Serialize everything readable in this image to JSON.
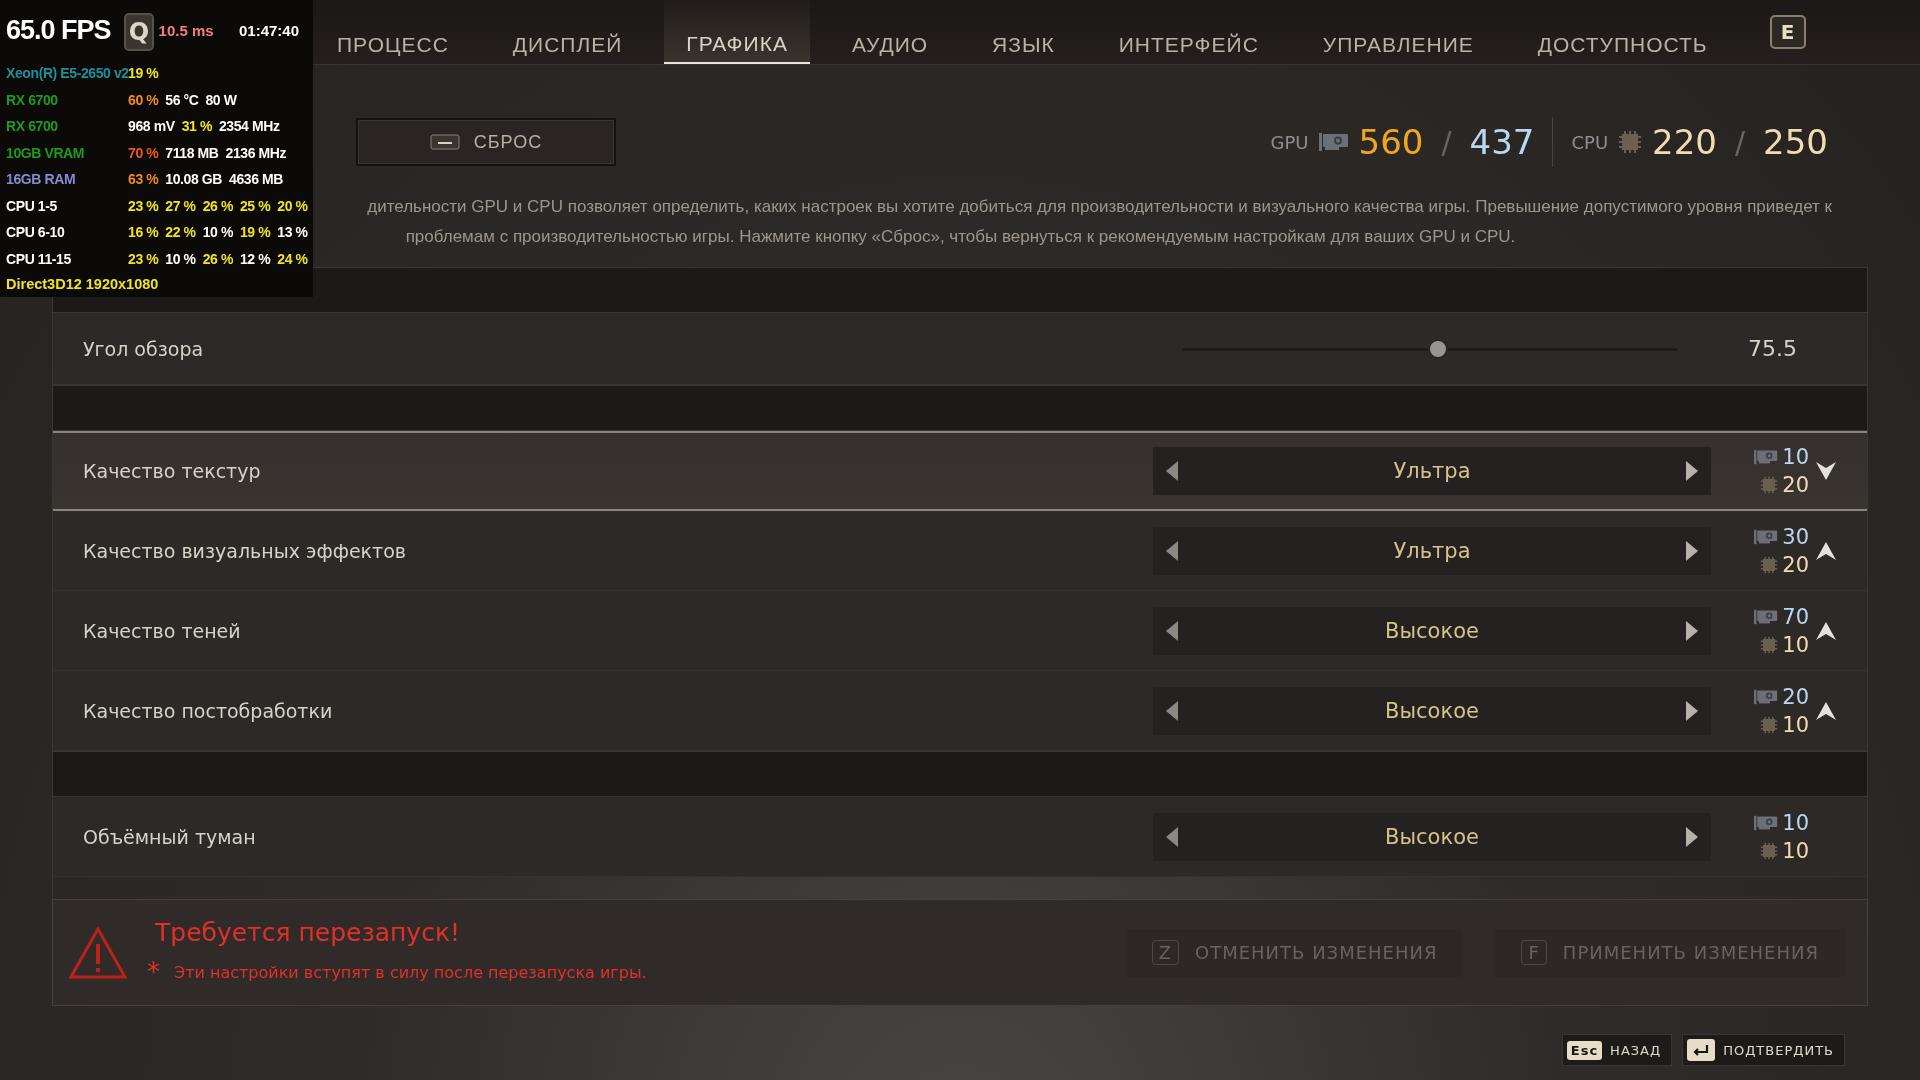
{
  "tabs": {
    "prev_key": "Q",
    "next_key": "E",
    "items": [
      {
        "label": "ПРОЦЕСС",
        "selected": false
      },
      {
        "label": "ДИСПЛЕЙ",
        "selected": false
      },
      {
        "label": "ГРАФИКА",
        "selected": true
      },
      {
        "label": "АУДИО",
        "selected": false
      },
      {
        "label": "ЯЗЫК",
        "selected": false
      },
      {
        "label": "ИНТЕРФЕЙС",
        "selected": false
      },
      {
        "label": "УПРАВЛЕНИЕ",
        "selected": false
      },
      {
        "label": "ДОСТУПНОСТЬ",
        "selected": false
      }
    ]
  },
  "toolbar": {
    "reset_button": "СБРОС"
  },
  "budget": {
    "gpu_label": "GPU",
    "gpu_used": "560",
    "gpu_max": "437",
    "cpu_label": "CPU",
    "cpu_used": "220",
    "cpu_max": "250",
    "separator": "/"
  },
  "description_lines": [
    "дительности GPU и CPU позволяет определить, каких настроек вы хотите добиться для производительности и визуального качества игры. Превышение допустимого уровня приведет к",
    "проблемам с производительностью игры. Нажмите кнопку «Сброс», чтобы вернуться к рекомендуемым настройкам для ваших GPU и CPU."
  ],
  "sections": [
    {
      "rows": [
        {
          "kind": "slider",
          "label": "Угол обзора",
          "level": 0.52,
          "value": "75.5",
          "selected": false
        }
      ]
    },
    {
      "rows": [
        {
          "kind": "selector",
          "label": "Качество текстур",
          "value": "Ультра",
          "gpu": "10",
          "cpu": "20",
          "raised": false,
          "lowered": true,
          "selected": true
        },
        {
          "kind": "selector",
          "label": "Качество визуальных эффектов",
          "value": "Ультра",
          "gpu": "30",
          "cpu": "20",
          "raised": true,
          "lowered": false,
          "selected": false
        },
        {
          "kind": "selector",
          "label": "Качество теней",
          "value": "Высокое",
          "gpu": "70",
          "cpu": "10",
          "raised": true,
          "lowered": false,
          "selected": false
        },
        {
          "kind": "selector",
          "label": "Качество постобработки",
          "value": "Высокое",
          "gpu": "20",
          "cpu": "10",
          "raised": true,
          "lowered": false,
          "selected": false
        }
      ]
    },
    {
      "rows": [
        {
          "kind": "selector",
          "label": "Объёмный туман",
          "value": "Высокое",
          "gpu": "10",
          "cpu": "10",
          "raised": false,
          "lowered": false,
          "selected": false
        }
      ]
    }
  ],
  "restart": {
    "title": "Требуется перезапуск!",
    "mark": "*",
    "note": "Эти настройки вступят в силу после перезапуска игры."
  },
  "actions": [
    {
      "key": "Z",
      "label": "ОТМЕНИТЬ ИЗМЕНЕНИЯ",
      "disabled": true
    },
    {
      "key": "F",
      "label": "ПРИМЕНИТЬ ИЗМЕНЕНИЯ",
      "disabled": true
    }
  ],
  "hints": [
    {
      "key": "Esc",
      "label": "НАЗАД",
      "kind": "text"
    },
    {
      "label": "ПОДТВЕРДИТЬ",
      "kind": "enter"
    }
  ],
  "overlay": {
    "fps": "65.0 FPS",
    "frametime": "10.5 ms",
    "clock": "01:47:40",
    "rows": [
      {
        "label": "Xeon(R) E5-2650 v2",
        "color": "#1f8f96",
        "values": [
          {
            "text": "19 %",
            "color": "#f2e41c"
          }
        ]
      },
      {
        "label": "RX 6700",
        "color": "#1f9a1f",
        "values": [
          {
            "text": "60 %",
            "color": "#f08a1e"
          },
          {
            "text": "56 °C",
            "color": "#ffffff"
          },
          {
            "text": "80 W",
            "color": "#ffffff"
          }
        ]
      },
      {
        "label": "RX 6700",
        "color": "#1f9a1f",
        "values": [
          {
            "text": "968 mV",
            "color": "#ffffff"
          },
          {
            "text": "31 %",
            "color": "#f2e41c"
          },
          {
            "text": "2354 MHz",
            "color": "#ffffff"
          }
        ]
      },
      {
        "label": "10GB VRAM",
        "color": "#1f9a1f",
        "values": [
          {
            "text": "70 %",
            "color": "#f2561e"
          },
          {
            "text": "7118 MB",
            "color": "#ffffff"
          },
          {
            "text": "2136 MHz",
            "color": "#ffffff"
          }
        ]
      },
      {
        "label": "16GB RAM",
        "color": "#8a8ad0",
        "values": [
          {
            "text": "63 %",
            "color": "#f08a1e"
          },
          {
            "text": "10.08 GB",
            "color": "#ffffff"
          },
          {
            "text": "4636 MB",
            "color": "#ffffff"
          }
        ]
      },
      {
        "label": "CPU 1-5",
        "color": "#ffffff",
        "values": [
          {
            "text": "23 %",
            "color": "#f2e41c"
          },
          {
            "text": "27 %",
            "color": "#f2e41c"
          },
          {
            "text": "26 %",
            "color": "#f2e41c"
          },
          {
            "text": "25 %",
            "color": "#f2e41c"
          },
          {
            "text": "20 %",
            "color": "#f2e41c"
          }
        ]
      },
      {
        "label": "CPU 6-10",
        "color": "#ffffff",
        "values": [
          {
            "text": "16 %",
            "color": "#f2e41c"
          },
          {
            "text": "22 %",
            "color": "#f2e41c"
          },
          {
            "text": "10 %",
            "color": "#ffffff"
          },
          {
            "text": "19 %",
            "color": "#f2e41c"
          },
          {
            "text": "13 %",
            "color": "#ffffff"
          }
        ]
      },
      {
        "label": "CPU 11-15",
        "color": "#ffffff",
        "values": [
          {
            "text": "23 %",
            "color": "#f2e41c"
          },
          {
            "text": "10 %",
            "color": "#ffffff"
          },
          {
            "text": "26 %",
            "color": "#f2e41c"
          },
          {
            "text": "12 %",
            "color": "#ffffff"
          },
          {
            "text": "24 %",
            "color": "#f2e41c"
          }
        ]
      }
    ],
    "api": "Direct3D12 1920x1080"
  }
}
